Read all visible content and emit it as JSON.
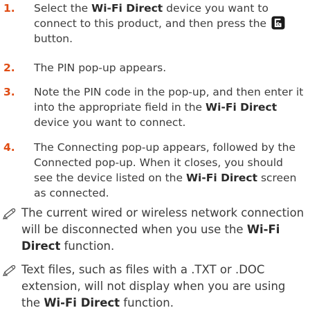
{
  "steps": [
    {
      "number": "1.",
      "a": "Select the ",
      "b": "Wi-Fi Direct",
      "c": " device you want to connect to this product, and then press the ",
      "d": "button."
    },
    {
      "number": "2.",
      "a": "The PIN pop-up appears."
    },
    {
      "number": "3.",
      "a": "Note the PIN code in the pop-up, and then enter it into the appropriate field in the ",
      "b": "Wi-Fi Direct",
      "c": " device you want to connect."
    },
    {
      "number": "4.",
      "a": "The Connecting pop-up appears, followed by the Connected pop-up. When it closes, you should see the device listed on the ",
      "b": "Wi-Fi Direct",
      "c": " screen as connected."
    }
  ],
  "notes": [
    {
      "a": "The current wired or wireless network connection will be disconnected when you use the ",
      "b": "Wi-Fi Direct",
      "c": " function."
    },
    {
      "a": "Text files, such as files with a .TXT or .DOC extension, will not display when you are using the ",
      "b": "Wi-Fi Direct",
      "c": " function."
    }
  ],
  "colors": {
    "step_number": "#e04c13",
    "body_text": "#3c3c3c",
    "icon": "#1a1a1a"
  },
  "icons": {
    "note": "pencil-icon",
    "enter_button": "enter-button-icon"
  }
}
